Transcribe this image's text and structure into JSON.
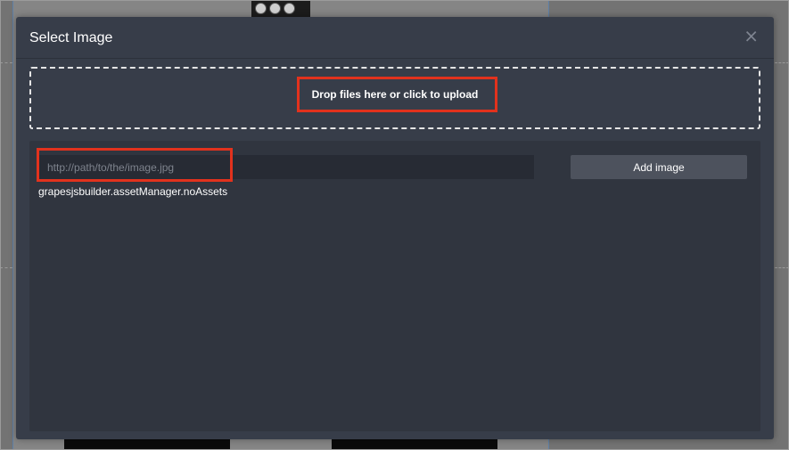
{
  "modal": {
    "title": "Select Image",
    "close_symbol": "⨯",
    "dropzone_text": "Drop files here or click to upload",
    "url_placeholder": "http://path/to/the/image.jpg",
    "url_value": "",
    "add_button_label": "Add image",
    "no_assets_text": "grapesjsbuilder.assetManager.noAssets"
  },
  "colors": {
    "modal_bg": "#373d49",
    "panel_bg": "#30353f",
    "highlight": "#e2321d"
  },
  "icons": {
    "close": "close-icon"
  }
}
